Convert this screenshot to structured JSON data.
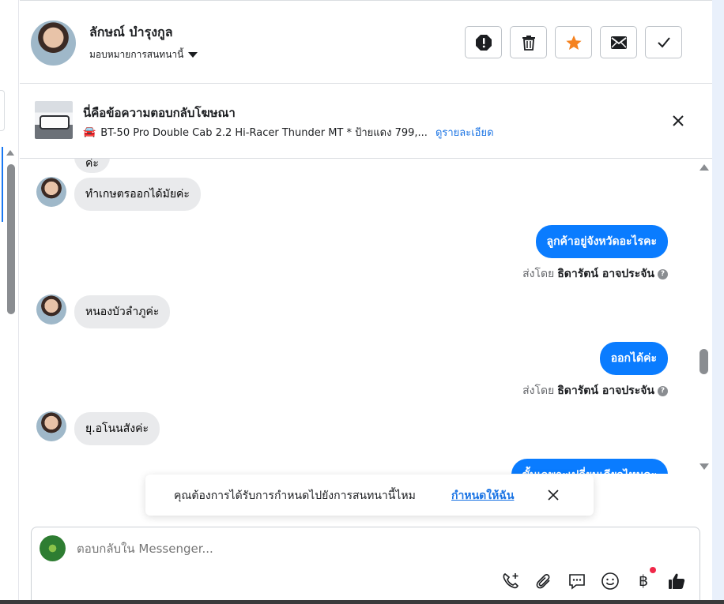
{
  "header": {
    "contact_name": "ลักษณ์ บำรุงกูล",
    "assign_label": "มอบหมายการสนทนานี้",
    "actions": [
      "report",
      "delete",
      "star",
      "mark-unread",
      "done"
    ],
    "star_color": "#f5821f"
  },
  "ad_reply": {
    "title": "นี่คือข้อความตอบกลับโฆษณา",
    "car_icon": "🚘",
    "subtitle": "BT-50 Pro Double Cab 2.2 Hi-Racer Thunder MT * ป้ายแดง 799,...",
    "details_link": "ดูรายละเอียด"
  },
  "messages": {
    "partial_top": "ค่ะ",
    "m1": "ทำเกษตรออกได้มัยค่ะ",
    "m2": "ลูกค้าอยู่จังหวัดอะไรคะ",
    "m2_sent_prefix": "ส่งโดย",
    "m2_sent_by": "ธิดารัตน์ อาจประจัน",
    "m3": "หนองบัวลำภูค่ะ",
    "m4": "ออกได้ค่ะ",
    "m4_sent_prefix": "ส่งโดย",
    "m4_sent_by": "ธิดารัตน์ อาจประจัน",
    "m5": "ยุ.อโนนสังค่ะ",
    "m6_partial": "ขั้นเฉพาะเปลี่ยนเดียวไหมคะ"
  },
  "toast": {
    "message": "คุณต้องการได้รับการกำหนดไปยังการสนทนานี้ไหม",
    "assign_me": "กำหนดให้ฉัน"
  },
  "composer": {
    "placeholder": "ตอบกลับใน Messenger...",
    "baht_symbol": "฿",
    "accent": "#0a7cff"
  }
}
